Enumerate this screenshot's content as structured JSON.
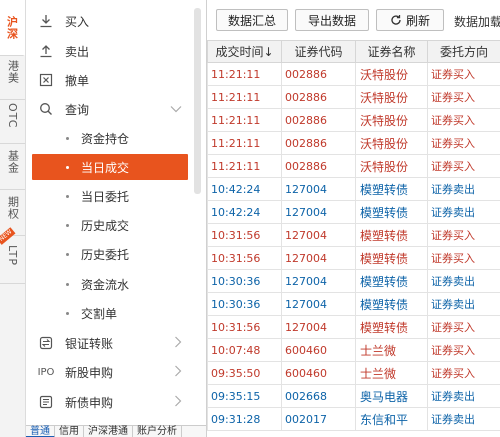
{
  "vertical_tabs": [
    {
      "label": "沪深",
      "active": true
    },
    {
      "label": "港美",
      "active": false
    },
    {
      "label": "OTC",
      "active": false
    },
    {
      "label": "基金",
      "active": false
    },
    {
      "label": "期权",
      "active": false
    },
    {
      "label": "LTP",
      "active": false,
      "badge": "NEW"
    }
  ],
  "menu": {
    "buy": "买入",
    "sell": "卖出",
    "cancel": "撤单",
    "query": "查询",
    "sub_items": [
      "资金持仓",
      "当日成交",
      "当日委托",
      "历史成交",
      "历史委托",
      "资金流水",
      "交割单"
    ],
    "selected_sub": "当日成交",
    "bank_transfer": "银证转账",
    "ipo_prefix": "IPO",
    "new_stock": "新股申购",
    "new_bond": "新债申购"
  },
  "bottom_tabs": [
    "普通",
    "信用",
    "沪深港通",
    "账户分析"
  ],
  "toolbar": {
    "summary_button": "数据汇总",
    "export_button": "导出数据",
    "refresh_button": "刷新",
    "refresh_icon": "refresh-icon",
    "title": "数据加载完"
  },
  "table": {
    "columns": [
      "成交时间↓",
      "证券代码",
      "证券名称",
      "委托方向"
    ],
    "rows": [
      {
        "time": "11:21:11",
        "code": "002886",
        "name": "沃特股份",
        "direction": "证券买入",
        "type": "buy"
      },
      {
        "time": "11:21:11",
        "code": "002886",
        "name": "沃特股份",
        "direction": "证券买入",
        "type": "buy"
      },
      {
        "time": "11:21:11",
        "code": "002886",
        "name": "沃特股份",
        "direction": "证券买入",
        "type": "buy"
      },
      {
        "time": "11:21:11",
        "code": "002886",
        "name": "沃特股份",
        "direction": "证券买入",
        "type": "buy"
      },
      {
        "time": "11:21:11",
        "code": "002886",
        "name": "沃特股份",
        "direction": "证券买入",
        "type": "buy"
      },
      {
        "time": "10:42:24",
        "code": "127004",
        "name": "模塑转债",
        "direction": "证券卖出",
        "type": "sell"
      },
      {
        "time": "10:42:24",
        "code": "127004",
        "name": "模塑转债",
        "direction": "证券卖出",
        "type": "sell"
      },
      {
        "time": "10:31:56",
        "code": "127004",
        "name": "模塑转债",
        "direction": "证券买入",
        "type": "buy"
      },
      {
        "time": "10:31:56",
        "code": "127004",
        "name": "模塑转债",
        "direction": "证券买入",
        "type": "buy"
      },
      {
        "time": "10:30:36",
        "code": "127004",
        "name": "模塑转债",
        "direction": "证券卖出",
        "type": "sell"
      },
      {
        "time": "10:30:36",
        "code": "127004",
        "name": "模塑转债",
        "direction": "证券卖出",
        "type": "sell"
      },
      {
        "time": "10:31:56",
        "code": "127004",
        "name": "模塑转债",
        "direction": "证券买入",
        "type": "buy"
      },
      {
        "time": "10:07:48",
        "code": "600460",
        "name": "士兰微",
        "direction": "证券买入",
        "type": "buy"
      },
      {
        "time": "09:35:50",
        "code": "600460",
        "name": "士兰微",
        "direction": "证券买入",
        "type": "buy"
      },
      {
        "time": "09:35:15",
        "code": "002668",
        "name": "奥马电器",
        "direction": "证券卖出",
        "type": "sell"
      },
      {
        "time": "09:31:28",
        "code": "002017",
        "name": "东信和平",
        "direction": "证券卖出",
        "type": "sell"
      }
    ]
  },
  "colors": {
    "accent": "#e8541e",
    "buy": "#c0392b",
    "sell": "#0d63a8"
  }
}
